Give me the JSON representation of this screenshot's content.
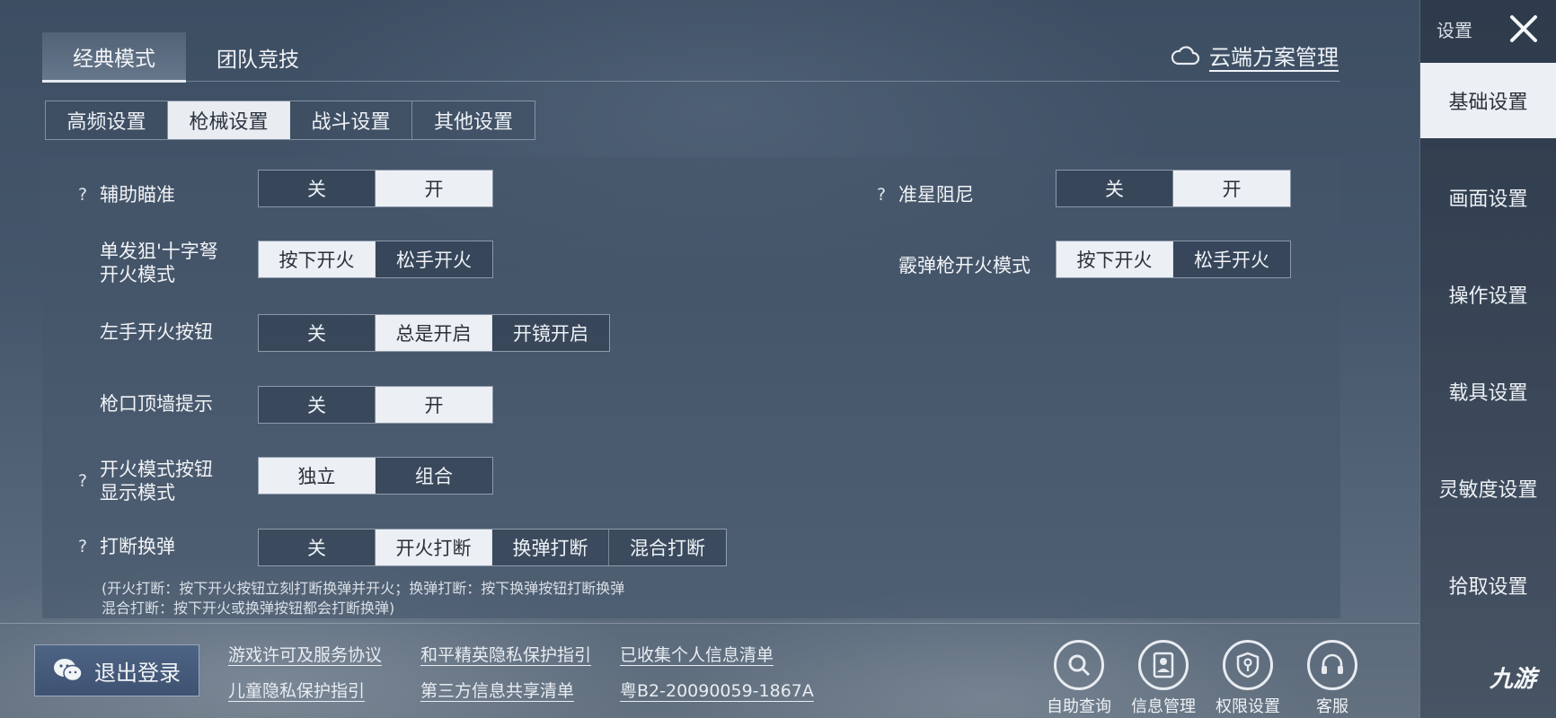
{
  "mode_tabs": [
    {
      "label": "经典模式",
      "active": true
    },
    {
      "label": "团队竞技",
      "active": false
    }
  ],
  "cloud": {
    "label": "云端方案管理",
    "icon": "cloud-icon"
  },
  "sub_tabs": [
    {
      "label": "高频设置",
      "active": false
    },
    {
      "label": "枪械设置",
      "active": true
    },
    {
      "label": "战斗设置",
      "active": false
    },
    {
      "label": "其他设置",
      "active": false
    }
  ],
  "settings": {
    "aim_assist": {
      "help": "?",
      "label": "辅助瞄准",
      "options": [
        "关",
        "开"
      ],
      "selected": 1
    },
    "crosshair_damping": {
      "help": "?",
      "label": "准星阻尼",
      "options": [
        "关",
        "开"
      ],
      "selected": 1
    },
    "sniper_fire": {
      "label_line1": "单发狙'十字弩",
      "label_line2": "开火模式",
      "options": [
        "按下开火",
        "松手开火"
      ],
      "selected": 0
    },
    "shotgun_fire": {
      "label": "霰弹枪开火模式",
      "options": [
        "按下开火",
        "松手开火"
      ],
      "selected": 0
    },
    "left_fire": {
      "label": "左手开火按钮",
      "options": [
        "关",
        "总是开启",
        "开镜开启"
      ],
      "selected": 1
    },
    "muzzle_wall": {
      "label": "枪口顶墙提示",
      "options": [
        "关",
        "开"
      ],
      "selected": 1
    },
    "fire_button_display": {
      "help": "?",
      "label_line1": "开火模式按钮",
      "label_line2": "显示模式",
      "options": [
        "独立",
        "组合"
      ],
      "selected": 0
    },
    "reload_interrupt": {
      "help": "?",
      "label": "打断换弹",
      "options": [
        "关",
        "开火打断",
        "换弹打断",
        "混合打断"
      ],
      "selected": 1
    }
  },
  "note": {
    "line1": "(开火打断：按下开火按钮立刻打断换弹并开火；换弹打断：按下换弹按钮打断换弹",
    "line2": "混合打断：按下开火或换弹按钮都会打断换弹)"
  },
  "bottom": {
    "logout_label": "退出登录",
    "links": {
      "license": "游戏许可及服务协议",
      "privacy": "和平精英隐私保护指引",
      "collected": "已收集个人信息清单",
      "child": "儿童隐私保护指引",
      "third_party": "第三方信息共享清单",
      "icp": "粤B2-20090059-1867A"
    },
    "icons": [
      {
        "label": "自助查询",
        "icon": "search-icon"
      },
      {
        "label": "信息管理",
        "icon": "id-card-icon"
      },
      {
        "label": "权限设置",
        "icon": "shield-key-icon"
      },
      {
        "label": "客服",
        "icon": "headset-icon"
      }
    ]
  },
  "sidebar": {
    "title": "设置",
    "items": [
      {
        "label": "基础设置",
        "active": true
      },
      {
        "label": "画面设置",
        "active": false
      },
      {
        "label": "操作设置",
        "active": false
      },
      {
        "label": "载具设置",
        "active": false
      },
      {
        "label": "灵敏度设置",
        "active": false
      },
      {
        "label": "拾取设置",
        "active": false
      }
    ]
  },
  "watermark": "九游"
}
